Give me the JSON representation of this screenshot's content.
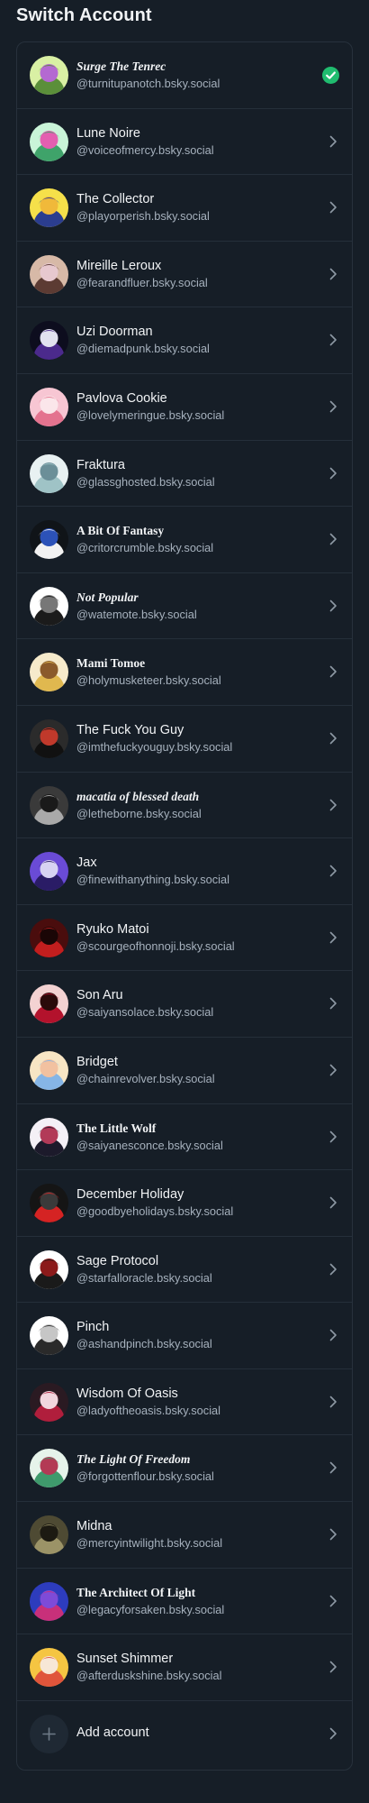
{
  "header": {
    "title": "Switch Account"
  },
  "accounts": [
    {
      "name": "Surge The Tenrec",
      "handle": "@turnitupanotch.bsky.social",
      "style": "fancy",
      "selected": true,
      "colors": [
        "#d9f0a4",
        "#5b8f3a",
        "#b469d1"
      ]
    },
    {
      "name": "Lune Noire",
      "handle": "@voiceofmercy.bsky.social",
      "style": "",
      "selected": false,
      "colors": [
        "#c9f4d8",
        "#3fa36a",
        "#e45fb0"
      ]
    },
    {
      "name": "The Collector",
      "handle": "@playorperish.bsky.social",
      "style": "",
      "selected": false,
      "colors": [
        "#f5e04a",
        "#2b3d8f",
        "#f0b93a"
      ]
    },
    {
      "name": "Mireille Leroux",
      "handle": "@fearandfluer.bsky.social",
      "style": "",
      "selected": false,
      "colors": [
        "#d7b9a7",
        "#5c3b33",
        "#e7c8cf"
      ]
    },
    {
      "name": "Uzi Doorman",
      "handle": "@diemadpunk.bsky.social",
      "style": "",
      "selected": false,
      "colors": [
        "#0d0d1e",
        "#4b2a8c",
        "#e2e2f0"
      ]
    },
    {
      "name": "Pavlova Cookie",
      "handle": "@lovelymeringue.bsky.social",
      "style": "",
      "selected": false,
      "colors": [
        "#f7c6d3",
        "#e4738f",
        "#fbe6ea"
      ]
    },
    {
      "name": "Fraktura",
      "handle": "@glassghosted.bsky.social",
      "style": "",
      "selected": false,
      "colors": [
        "#e8f1f2",
        "#9fc3c6",
        "#6b8f98"
      ]
    },
    {
      "name": "A Bit Of Fantasy",
      "handle": "@critorcrumble.bsky.social",
      "style": "gothic",
      "selected": false,
      "colors": [
        "#101418",
        "#f2f2f2",
        "#2c52b8"
      ]
    },
    {
      "name": "Not Popular",
      "handle": "@watemote.bsky.social",
      "style": "fancy",
      "selected": false,
      "colors": [
        "#ffffff",
        "#1b1b1b",
        "#777777"
      ]
    },
    {
      "name": "Mami Tomoe",
      "handle": "@holymusketeer.bsky.social",
      "style": "gothic",
      "selected": false,
      "colors": [
        "#f6eacb",
        "#e0b84f",
        "#8a5a2b"
      ]
    },
    {
      "name": "The Fuck You Guy",
      "handle": "@imthefuckyouguy.bsky.social",
      "style": "",
      "selected": false,
      "colors": [
        "#2b2b2b",
        "#111111",
        "#c0392b"
      ]
    },
    {
      "name": "macatia of blessed death",
      "handle": "@letheborne.bsky.social",
      "style": "fancy",
      "selected": false,
      "colors": [
        "#3a3a3a",
        "#a9a9a9",
        "#1a1a1a"
      ]
    },
    {
      "name": "Jax",
      "handle": "@finewithanything.bsky.social",
      "style": "",
      "selected": false,
      "colors": [
        "#6a4bd6",
        "#2a1c66",
        "#d7d3f2"
      ]
    },
    {
      "name": "Ryuko Matoi",
      "handle": "@scourgeofhonnoji.bsky.social",
      "style": "",
      "selected": false,
      "colors": [
        "#4a0d0d",
        "#c21e1e",
        "#1a0606"
      ]
    },
    {
      "name": "Son Aru",
      "handle": "@saiyansolace.bsky.social",
      "style": "",
      "selected": false,
      "colors": [
        "#f3d2d2",
        "#b3122c",
        "#2a0a0a"
      ]
    },
    {
      "name": "Bridget",
      "handle": "@chainrevolver.bsky.social",
      "style": "",
      "selected": false,
      "colors": [
        "#f7e5c4",
        "#86b5e6",
        "#f2c1a0"
      ]
    },
    {
      "name": "The Little Wolf",
      "handle": "@saiyanesconce.bsky.social",
      "style": "gothic",
      "selected": false,
      "colors": [
        "#f4f0f6",
        "#1c1a2b",
        "#b23a58"
      ]
    },
    {
      "name": "December Holiday",
      "handle": "@goodbyeholidays.bsky.social",
      "style": "",
      "selected": false,
      "colors": [
        "#151515",
        "#d52323",
        "#3a3a3a"
      ]
    },
    {
      "name": "Sage Protocol",
      "handle": "@starfalloracle.bsky.social",
      "style": "",
      "selected": false,
      "colors": [
        "#ffffff",
        "#1a1a1a",
        "#8b1a1a"
      ]
    },
    {
      "name": "Pinch",
      "handle": "@ashandpinch.bsky.social",
      "style": "",
      "selected": false,
      "colors": [
        "#ffffff",
        "#2a2a2a",
        "#c6c6c6"
      ]
    },
    {
      "name": "Wisdom Of Oasis",
      "handle": "@ladyoftheoasis.bsky.social",
      "style": "",
      "selected": false,
      "colors": [
        "#2a1a22",
        "#b01e3c",
        "#f1d6de"
      ]
    },
    {
      "name": "The Light Of Freedom",
      "handle": "@forgottenflour.bsky.social",
      "style": "fancy",
      "selected": false,
      "colors": [
        "#e6f3ea",
        "#3f9a6c",
        "#b33a55"
      ]
    },
    {
      "name": "Midna",
      "handle": "@mercyintwilight.bsky.social",
      "style": "",
      "selected": false,
      "colors": [
        "#4e4a33",
        "#9b9367",
        "#1c1a12"
      ]
    },
    {
      "name": "The Architect Of Light",
      "handle": "@legacyforsaken.bsky.social",
      "style": "gothic",
      "selected": false,
      "colors": [
        "#2d3cbd",
        "#c8307a",
        "#7e4bd8"
      ]
    },
    {
      "name": "Sunset Shimmer",
      "handle": "@afterduskshine.bsky.social",
      "style": "",
      "selected": false,
      "colors": [
        "#f5c542",
        "#e0553b",
        "#f7e7d6"
      ]
    }
  ],
  "add_account": {
    "label": "Add account"
  },
  "colors": {
    "accent_check": "#20bc6f",
    "background": "#161e27",
    "border": "#27313c",
    "muted_text": "#a6b1bd"
  },
  "icons": {
    "selected": "check-circle-icon",
    "row_action": "chevron-right-icon",
    "add": "plus-icon"
  }
}
